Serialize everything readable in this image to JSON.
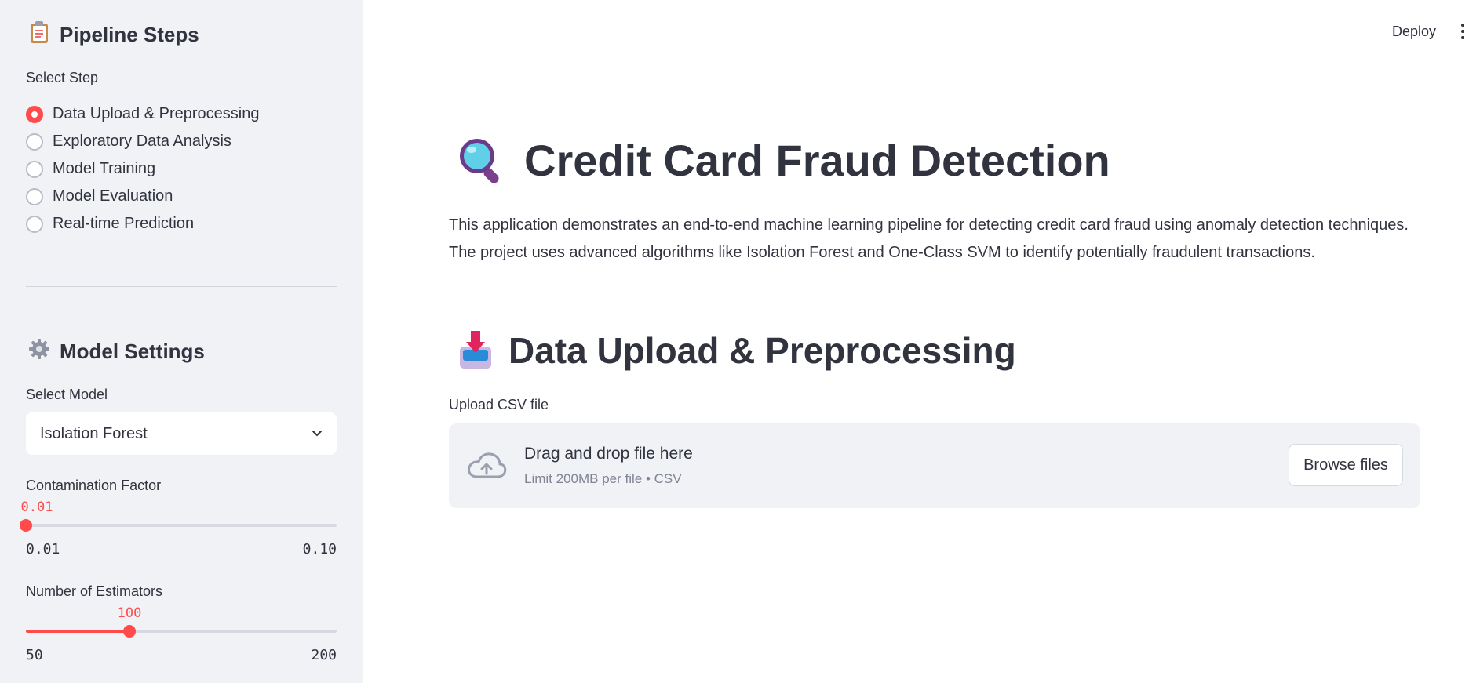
{
  "sidebar": {
    "pipeline_header": "Pipeline Steps",
    "select_step_label": "Select Step",
    "steps": [
      {
        "label": "Data Upload & Preprocessing",
        "checked": true
      },
      {
        "label": "Exploratory Data Analysis",
        "checked": false
      },
      {
        "label": "Model Training",
        "checked": false
      },
      {
        "label": "Model Evaluation",
        "checked": false
      },
      {
        "label": "Real-time Prediction",
        "checked": false
      }
    ],
    "model_settings_header": "Model Settings",
    "select_model_label": "Select Model",
    "selected_model": "Isolation Forest",
    "contamination": {
      "label": "Contamination Factor",
      "value": "0.01",
      "min": "0.01",
      "max": "0.10",
      "fraction": 0.0
    },
    "estimators": {
      "label": "Number of Estimators",
      "value": "100",
      "min": "50",
      "max": "200",
      "fraction": 0.333
    }
  },
  "topbar": {
    "deploy_label": "Deploy"
  },
  "main": {
    "title": "Credit Card Fraud Detection",
    "intro": "This application demonstrates an end-to-end machine learning pipeline for detecting credit card fraud using anomaly detection techniques. The project uses advanced algorithms like Isolation Forest and One-Class SVM to identify potentially fraudulent transactions.",
    "section_title": "Data Upload & Preprocessing",
    "upload_label": "Upload CSV file",
    "drop_text": "Drag and drop file here",
    "limit_text": "Limit 200MB per file • CSV",
    "browse_label": "Browse files"
  },
  "colors": {
    "accent": "#ff4b4b",
    "sidebar_bg": "#f0f2f6",
    "text": "#31333f"
  }
}
